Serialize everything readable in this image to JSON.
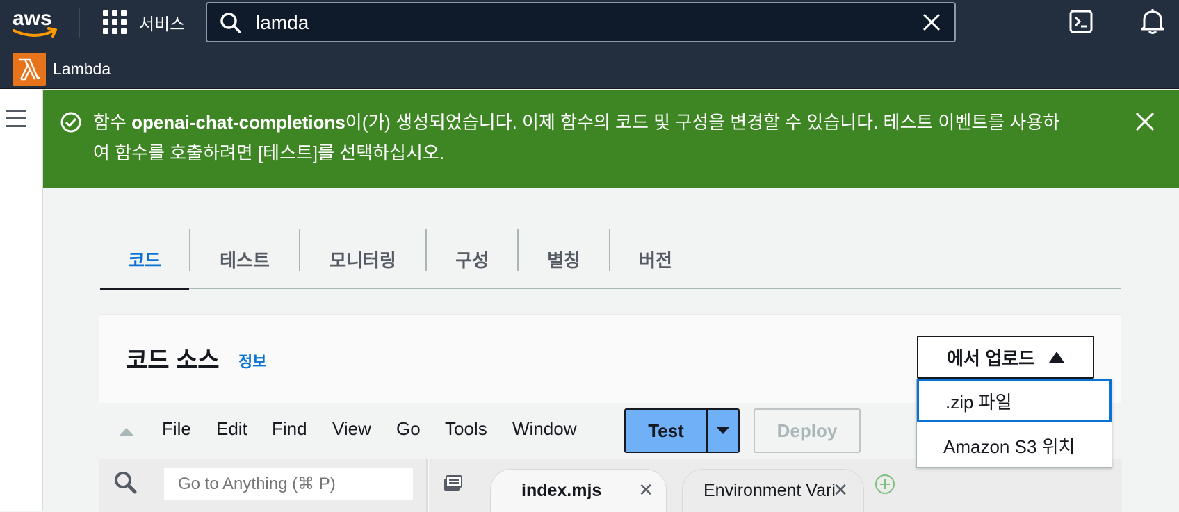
{
  "topbar": {
    "logo_text": "aws",
    "services_label": "서비스",
    "search": {
      "value": "lamda"
    }
  },
  "service": {
    "name": "Lambda"
  },
  "banner": {
    "prefix": "함수 ",
    "function_name": "openai-chat-completions",
    "line1_suffix": "이(가) 생성되었습니다. 이제 함수의 코드 및 구성을 변경할 수 있습니다. 테스트 이벤트를 사용하",
    "line2": "여 함수를 호출하려면 [테스트]를 선택하십시오."
  },
  "tabs": [
    {
      "label": "코드",
      "active": true
    },
    {
      "label": "테스트"
    },
    {
      "label": "모니터링"
    },
    {
      "label": "구성"
    },
    {
      "label": "별칭"
    },
    {
      "label": "버전"
    }
  ],
  "code_source": {
    "title": "코드 소스",
    "info_label": "정보",
    "upload_label": "에서 업로드",
    "upload_options": [
      ".zip 파일",
      "Amazon S3 위치"
    ]
  },
  "ide": {
    "menu": [
      "File",
      "Edit",
      "Find",
      "View",
      "Go",
      "Tools",
      "Window"
    ],
    "test_label": "Test",
    "deploy_label": "Deploy",
    "goto_placeholder": "Go to Anything (⌘ P)",
    "editor_tabs": [
      "index.mjs",
      "Environment Vari"
    ]
  }
}
